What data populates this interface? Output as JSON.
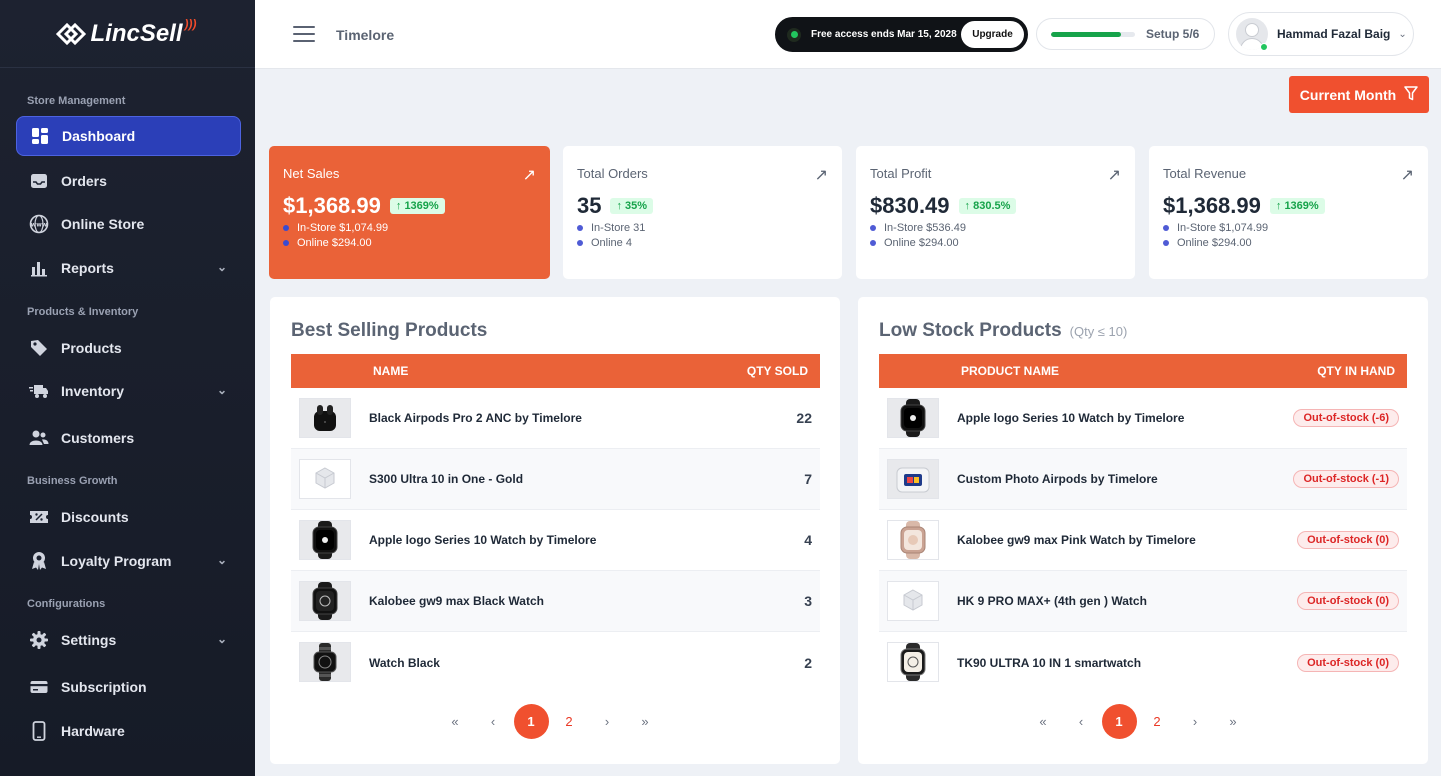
{
  "brand": {
    "name": "LincSell",
    "accent": "#ea6238"
  },
  "sidebar": {
    "sections": {
      "store": "Store Management",
      "products": "Products & Inventory",
      "growth": "Business Growth",
      "config": "Configurations"
    },
    "items": [
      {
        "label": "Dashboard",
        "icon": "grid-icon",
        "active": true
      },
      {
        "label": "Orders",
        "icon": "inbox-icon"
      },
      {
        "label": "Online Store",
        "icon": "globe-icon"
      },
      {
        "label": "Reports",
        "icon": "bar-chart-icon"
      },
      {
        "label": "Products",
        "icon": "tag-icon"
      },
      {
        "label": "Inventory",
        "icon": "truck-icon"
      },
      {
        "label": "Customers",
        "icon": "users-icon"
      },
      {
        "label": "Discounts",
        "icon": "coupon-icon"
      },
      {
        "label": "Loyalty Program",
        "icon": "medal-icon"
      },
      {
        "label": "Settings",
        "icon": "gear-icon"
      },
      {
        "label": "Subscription",
        "icon": "card-icon"
      },
      {
        "label": "Hardware",
        "icon": "phone-icon"
      }
    ]
  },
  "header": {
    "store_name": "Timelore",
    "trial_text": "Free access ends Mar 15, 2028",
    "upgrade_label": "Upgrade",
    "setup_label": "Setup 5/6",
    "setup_progress": 0.83,
    "user_name": "Hammad Fazal Baig"
  },
  "filter": {
    "label": "Current Month"
  },
  "stats": [
    {
      "title": "Net Sales",
      "value": "$1,368.99",
      "change": "1369%",
      "line1": "In-Store $1,074.99",
      "line2": "Online $294.00"
    },
    {
      "title": "Total Orders",
      "value": "35",
      "change": "35%",
      "line1": "In-Store 31",
      "line2": "Online 4"
    },
    {
      "title": "Total Profit",
      "value": "$830.49",
      "change": "830.5%",
      "line1": "In-Store $536.49",
      "line2": "Online $294.00"
    },
    {
      "title": "Total Revenue",
      "value": "$1,368.99",
      "change": "1369%",
      "line1": "In-Store $1,074.99",
      "line2": "Online $294.00"
    }
  ],
  "best_selling": {
    "title": "Best Selling Products",
    "col_name": "NAME",
    "col_qty": "QTY SOLD",
    "rows": [
      {
        "name": "Black Airpods Pro 2 ANC by Timelore",
        "qty": "22"
      },
      {
        "name": "S300 Ultra 10 in One - Gold",
        "qty": "7"
      },
      {
        "name": "Apple logo Series 10 Watch by Timelore",
        "qty": "4"
      },
      {
        "name": "Kalobee gw9 max Black Watch",
        "qty": "3"
      },
      {
        "name": "Watch Black",
        "qty": "2"
      }
    ],
    "pages": [
      "1",
      "2"
    ]
  },
  "low_stock": {
    "title": "Low Stock Products",
    "subtitle": "(Qty ≤ 10)",
    "col_name": "PRODUCT NAME",
    "col_qty": "QTY IN HAND",
    "rows": [
      {
        "name": "Apple logo Series 10 Watch by Timelore",
        "status": "Out-of-stock (-6)"
      },
      {
        "name": "Custom Photo Airpods by Timelore",
        "status": "Out-of-stock (-1)"
      },
      {
        "name": "Kalobee gw9 max Pink Watch by Timelore",
        "status": "Out-of-stock (0)"
      },
      {
        "name": "HK 9 PRO MAX+ (4th gen ) Watch",
        "status": "Out-of-stock (0)"
      },
      {
        "name": "TK90 ULTRA 10 IN 1 smartwatch",
        "status": "Out-of-stock (0)"
      }
    ],
    "pages": [
      "1",
      "2"
    ]
  },
  "pager_icons": {
    "first": "«",
    "prev": "‹",
    "next": "›",
    "last": "»"
  }
}
